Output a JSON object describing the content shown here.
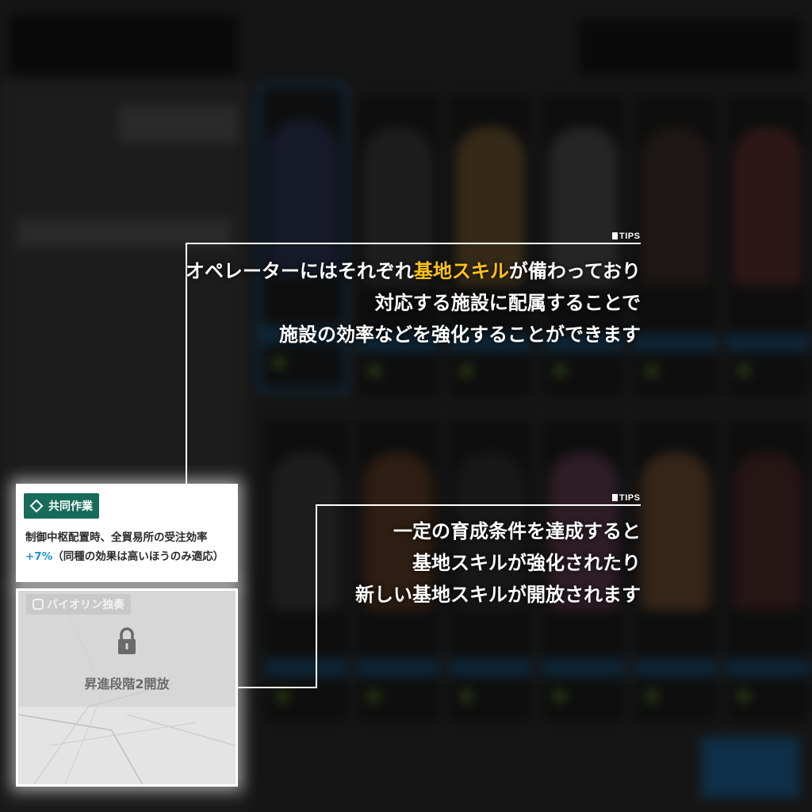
{
  "tips": [
    {
      "tag": "TIPS",
      "line1_before": "オペレーターにはそれぞれ",
      "line1_highlight": "基地スキル",
      "line1_after": "が備わっており",
      "line2": "対応する施設に配属することで",
      "line3": "施設の効率などを強化することができます"
    },
    {
      "tag": "TIPS",
      "line1": "一定の育成条件を達成すると",
      "line2": "基地スキルが強化されたり",
      "line3": "新しい基地スキルが開放されます"
    }
  ],
  "skill_unlocked": {
    "name": "共同作業",
    "desc_before": "制御中枢配置時、全貿易所の受注効率",
    "desc_value": "+7%",
    "desc_after": "（同種の効果は高いほうのみ適応）"
  },
  "skill_locked": {
    "name": "バイオリン独奏",
    "lock_message": "昇進段階2開放"
  },
  "colors": {
    "highlight": "#ffc21a",
    "badge": "#176b5a",
    "bonus": "#1c8fd6"
  }
}
